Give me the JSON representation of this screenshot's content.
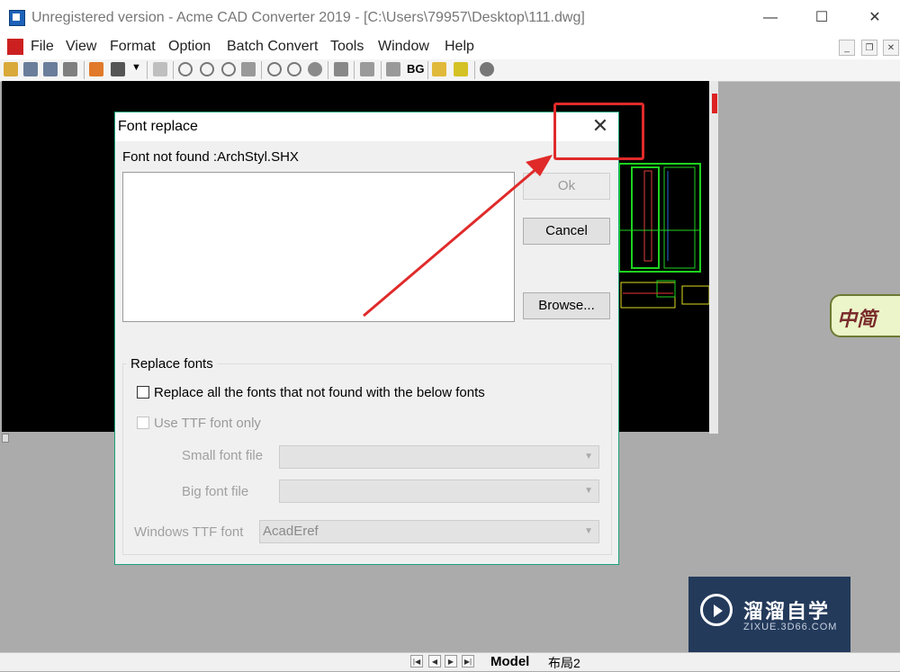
{
  "window": {
    "title": "Unregistered version - Acme CAD Converter 2019 - [C:\\Users\\79957\\Desktop\\111.dwg]",
    "minimize": "—",
    "maximize": "☐",
    "close": "✕"
  },
  "menu": {
    "items": [
      "File",
      "View",
      "Format",
      "Option",
      "Batch Convert",
      "Tools",
      "Window",
      "Help"
    ],
    "mdi_minimize": "_",
    "mdi_restore": "❐",
    "mdi_close": "✕"
  },
  "toolbar": {
    "bg_label": "BG"
  },
  "bottom_tabs": {
    "model": "Model",
    "layout": "布局2"
  },
  "dialog": {
    "title": "Font replace",
    "close": "✕",
    "message": "Font not found :ArchStyl.SHX",
    "ok": "Ok",
    "cancel": "Cancel",
    "browse": "Browse...",
    "group_label": "Replace fonts",
    "replace_all": "Replace all the fonts that not found with the below fonts",
    "ttf_only": "Use TTF font only",
    "small_font_label": "Small font file",
    "big_font_label": "Big font file",
    "windows_ttf_label": "Windows TTF font",
    "windows_ttf_value": "AcadEref"
  },
  "watermark": {
    "title": "溜溜自学",
    "subtitle": "ZIXUE.3D66.COM"
  },
  "badge": {
    "text": "中简"
  },
  "colors": {
    "highlight": "#e02a2a",
    "dialog_border": "#1aa27a",
    "canvas": "#000000"
  }
}
